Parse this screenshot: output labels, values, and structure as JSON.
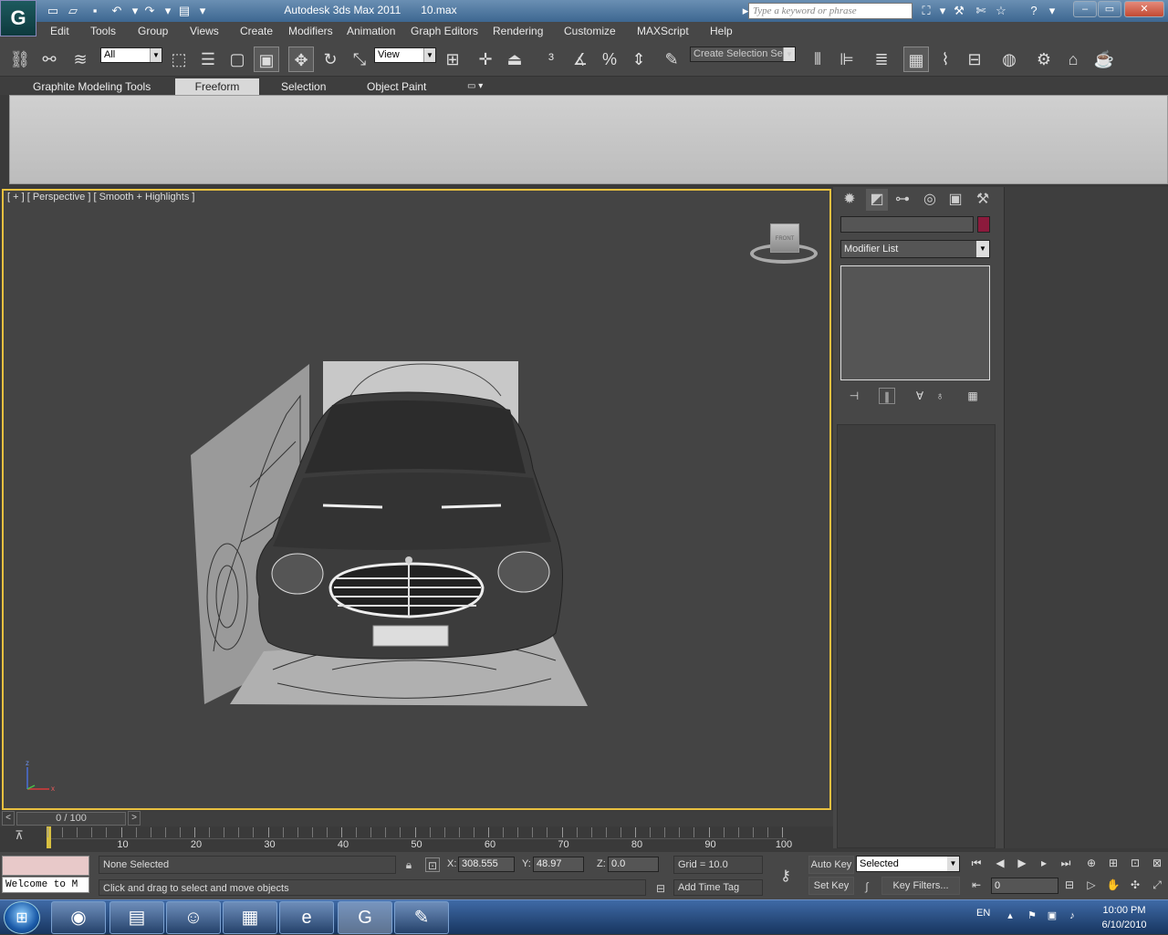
{
  "window": {
    "app": "Autodesk 3ds Max  2011",
    "file": "10.max",
    "search_placeholder": "Type a keyword or phrase",
    "logo": "G"
  },
  "menu": [
    "Edit",
    "Tools",
    "Group",
    "Views",
    "Create",
    "Modifiers",
    "Animation",
    "Graph Editors",
    "Rendering",
    "Customize",
    "MAXScript",
    "Help"
  ],
  "toolbar": {
    "filter_value": "All",
    "refcoord_value": "View",
    "selset_value": "Create Selection Se"
  },
  "ribbon": {
    "tabs": [
      "Graphite Modeling Tools",
      "Freeform",
      "Selection",
      "Object Paint"
    ],
    "active": 1
  },
  "viewport": {
    "label": "[ + ] [ Perspective ] [ Smooth + Highlights ]",
    "viewcube_face": "FRONT",
    "axis_z": "z",
    "axis_x": "x"
  },
  "command_panel": {
    "modifier_list": "Modifier List",
    "object_color": "#8c1a3c",
    "icons": [
      "create-icon",
      "modify-icon",
      "hierarchy-icon",
      "motion-icon",
      "display-icon",
      "utilities-icon"
    ]
  },
  "timeslider": {
    "position": "0 / 100",
    "prev": "<",
    "next": ">"
  },
  "trackbar": {
    "labels": [
      "10",
      "20",
      "30",
      "40",
      "50",
      "60",
      "70",
      "80",
      "90",
      "100"
    ]
  },
  "status": {
    "selection": "None Selected",
    "script_listener": "Welcome to M",
    "prompt": "Click and drag to select and move objects",
    "x_label": "X:",
    "x_value": "308.555",
    "y_label": "Y:",
    "y_value": "48.97",
    "z_label": "Z:",
    "z_value": "0.0",
    "grid": "Grid = 10.0",
    "add_time_tag": "Add Time Tag",
    "auto_key": "Auto Key",
    "set_key": "Set Key",
    "selected_value": "Selected",
    "key_filters": "Key Filters...",
    "frame": "0"
  },
  "taskbar": {
    "lang": "EN",
    "time": "10:00 PM",
    "date": "6/10/2010"
  }
}
